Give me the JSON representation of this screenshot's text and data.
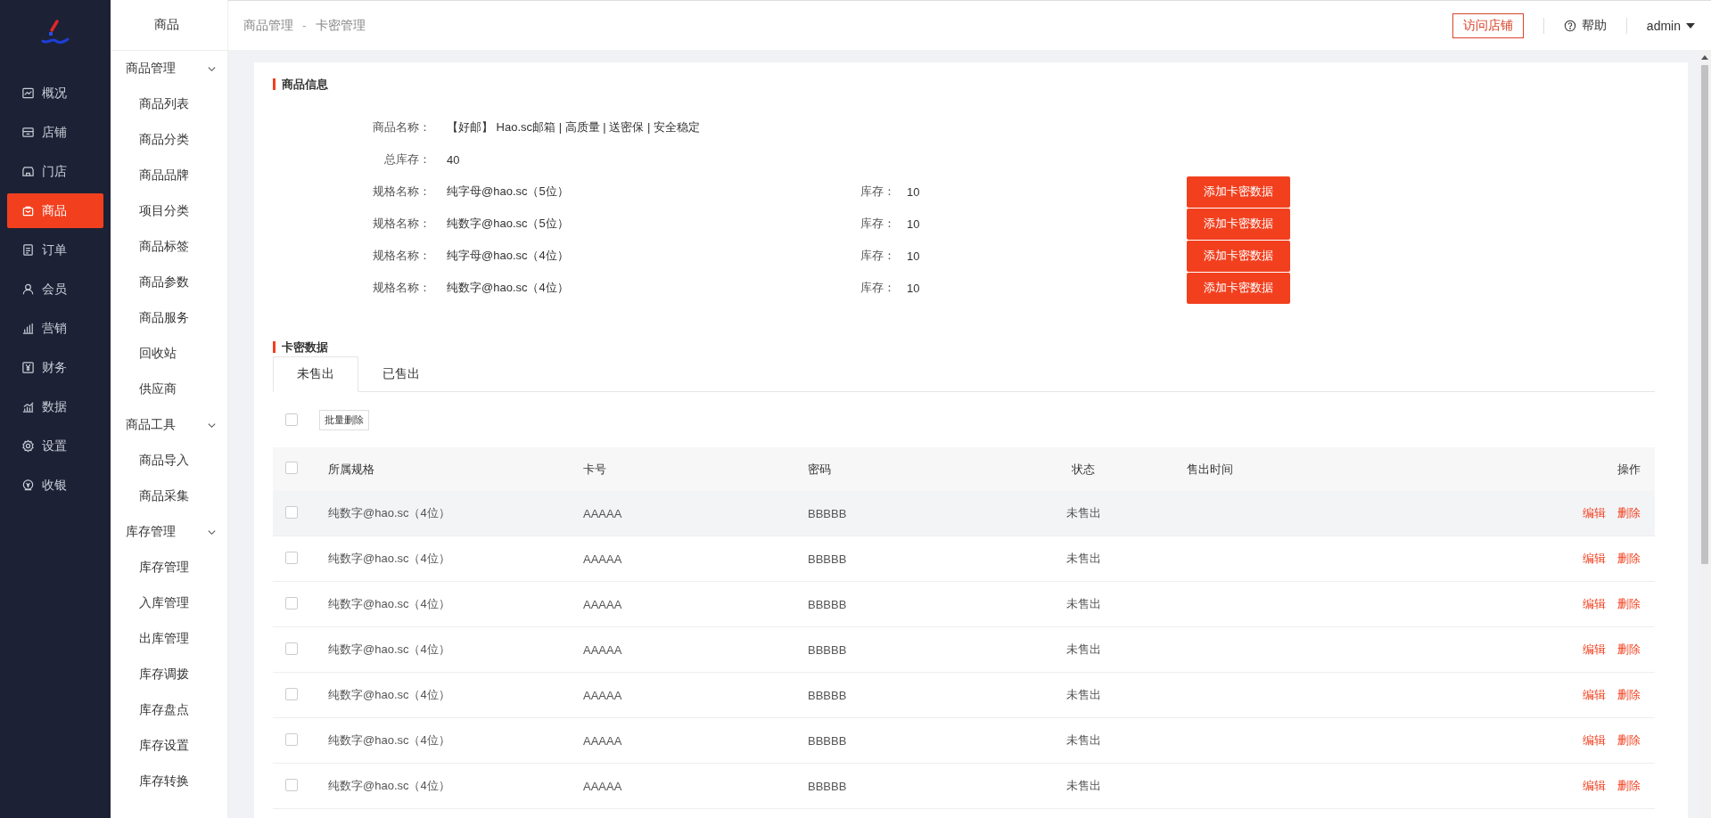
{
  "nav": [
    {
      "label": "概况",
      "selected": false
    },
    {
      "label": "店铺",
      "selected": false
    },
    {
      "label": "门店",
      "selected": false
    },
    {
      "label": "商品",
      "selected": true
    },
    {
      "label": "订单",
      "selected": false
    },
    {
      "label": "会员",
      "selected": false
    },
    {
      "label": "营销",
      "selected": false
    },
    {
      "label": "财务",
      "selected": false
    },
    {
      "label": "数据",
      "selected": false
    },
    {
      "label": "设置",
      "selected": false
    },
    {
      "label": "收银",
      "selected": false
    }
  ],
  "submenu": {
    "title": "商品",
    "groups": [
      {
        "label": "商品管理",
        "expanded": true,
        "children": [
          {
            "label": "商品列表"
          },
          {
            "label": "商品分类"
          },
          {
            "label": "商品品牌"
          },
          {
            "label": "项目分类"
          },
          {
            "label": "商品标签"
          },
          {
            "label": "商品参数"
          },
          {
            "label": "商品服务"
          },
          {
            "label": "回收站"
          },
          {
            "label": "供应商"
          }
        ]
      },
      {
        "label": "商品工具",
        "expanded": true,
        "children": [
          {
            "label": "商品导入"
          },
          {
            "label": "商品采集"
          }
        ]
      },
      {
        "label": "库存管理",
        "expanded": true,
        "children": [
          {
            "label": "库存管理"
          },
          {
            "label": "入库管理"
          },
          {
            "label": "出库管理"
          },
          {
            "label": "库存调拨"
          },
          {
            "label": "库存盘点"
          },
          {
            "label": "库存设置"
          },
          {
            "label": "库存转换"
          }
        ]
      }
    ]
  },
  "breadcrumb": [
    "商品管理",
    "卡密管理"
  ],
  "breadcrumb_separator": "-",
  "header": {
    "visit_store": "访问店铺",
    "help": "帮助",
    "user": "admin"
  },
  "product_info": {
    "title": "商品信息",
    "fields": [
      {
        "label": "商品名称：",
        "value": "【好邮】 Hao.sc邮箱 | 高质量 | 送密保 | 安全稳定"
      },
      {
        "label": "总库存：",
        "value": "40"
      }
    ],
    "specs": [
      {
        "label": "规格名称：",
        "value": "纯字母@hao.sc（5位）",
        "stock_label": "库存：",
        "stock": "10",
        "button": "添加卡密数据"
      },
      {
        "label": "规格名称：",
        "value": "纯数字@hao.sc（5位）",
        "stock_label": "库存：",
        "stock": "10",
        "button": "添加卡密数据"
      },
      {
        "label": "规格名称：",
        "value": "纯字母@hao.sc（4位）",
        "stock_label": "库存：",
        "stock": "10",
        "button": "添加卡密数据"
      },
      {
        "label": "规格名称：",
        "value": "纯数字@hao.sc（4位）",
        "stock_label": "库存：",
        "stock": "10",
        "button": "添加卡密数据"
      }
    ]
  },
  "card_data": {
    "title": "卡密数据",
    "tabs": [
      {
        "label": "未售出",
        "selected": true
      },
      {
        "label": "已售出",
        "selected": false
      }
    ],
    "select_all_checked": false,
    "batch_delete": "批量删除",
    "header_checked": false,
    "columns": [
      "所属规格",
      "卡号",
      "密码",
      "状态",
      "售出时间",
      "操作"
    ],
    "rows": [
      {
        "checked": false,
        "hovered": true,
        "spec": "纯数字@hao.sc（4位）",
        "card_no": "AAAAA",
        "password": "BBBBB",
        "status": "未售出",
        "actions": [
          "编辑",
          "删除"
        ]
      },
      {
        "checked": false,
        "hovered": false,
        "spec": "纯数字@hao.sc（4位）",
        "card_no": "AAAAA",
        "password": "BBBBB",
        "status": "未售出",
        "actions": [
          "编辑",
          "删除"
        ]
      },
      {
        "checked": false,
        "hovered": false,
        "spec": "纯数字@hao.sc（4位）",
        "card_no": "AAAAA",
        "password": "BBBBB",
        "status": "未售出",
        "actions": [
          "编辑",
          "删除"
        ]
      },
      {
        "checked": false,
        "hovered": false,
        "spec": "纯数字@hao.sc（4位）",
        "card_no": "AAAAA",
        "password": "BBBBB",
        "status": "未售出",
        "actions": [
          "编辑",
          "删除"
        ]
      },
      {
        "checked": false,
        "hovered": false,
        "spec": "纯数字@hao.sc（4位）",
        "card_no": "AAAAA",
        "password": "BBBBB",
        "status": "未售出",
        "actions": [
          "编辑",
          "删除"
        ]
      },
      {
        "checked": false,
        "hovered": false,
        "spec": "纯数字@hao.sc（4位）",
        "card_no": "AAAAA",
        "password": "BBBBB",
        "status": "未售出",
        "actions": [
          "编辑",
          "删除"
        ]
      },
      {
        "checked": false,
        "hovered": false,
        "spec": "纯数字@hao.sc（4位）",
        "card_no": "AAAAA",
        "password": "BBBBB",
        "status": "未售出",
        "actions": [
          "编辑",
          "删除"
        ]
      }
    ]
  }
}
